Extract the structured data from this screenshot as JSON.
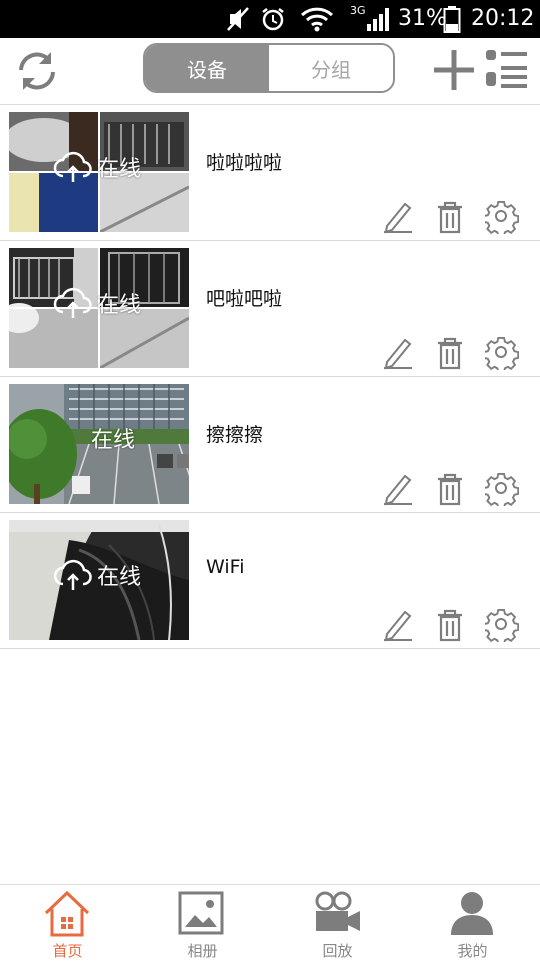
{
  "status_bar": {
    "network": "3G",
    "battery": "31%",
    "time": "20:12"
  },
  "segment": {
    "tabs": [
      "设备",
      "分组"
    ],
    "active_index": 0
  },
  "devices": [
    {
      "name": "啦啦啦啦",
      "status": "在线"
    },
    {
      "name": "吧啦吧啦",
      "status": "在线"
    },
    {
      "name": "擦擦擦",
      "status": "在线"
    },
    {
      "name": "WiFi",
      "status": "在线"
    }
  ],
  "bottom_nav": {
    "items": [
      "首页",
      "相册",
      "回放",
      "我的"
    ],
    "active_index": 0
  },
  "colors": {
    "accent": "#e86a3f",
    "gray": "#8f8f8f",
    "icon": "#7d7d7d"
  }
}
